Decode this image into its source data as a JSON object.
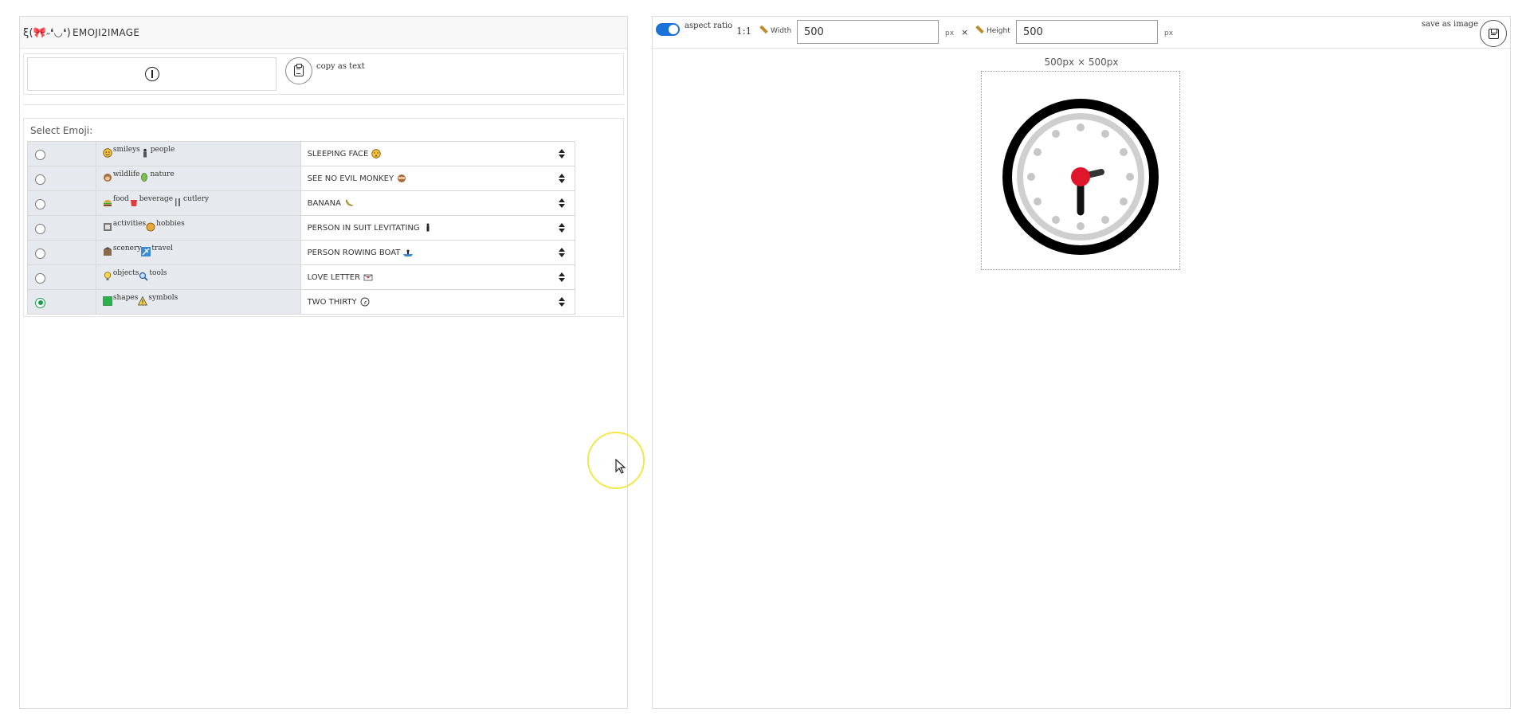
{
  "left": {
    "kaomoji": "ξ(🎀˶❛◡❛)",
    "title": "emoji2image",
    "copy_label": "copy as text",
    "select_title": "Select Emoji:",
    "rows": [
      {
        "cat1": "smileys",
        "cat2": "people",
        "selected": "SLEEPING FACE",
        "checked": false
      },
      {
        "cat1": "wildlife",
        "cat2": "nature",
        "selected": "SEE NO EVIL MONKEY",
        "checked": false
      },
      {
        "cat1": "food",
        "cat2": "beverage",
        "cat3": "cutlery",
        "selected": "BANANA",
        "checked": false
      },
      {
        "cat1": "activities",
        "cat2": "hobbies",
        "selected": "PERSON IN SUIT LEVITATING",
        "checked": false
      },
      {
        "cat1": "scenery",
        "cat2": "travel",
        "selected": "PERSON ROWING BOAT",
        "checked": false
      },
      {
        "cat1": "objects",
        "cat2": "tools",
        "selected": "LOVE LETTER",
        "checked": false
      },
      {
        "cat1": "shapes",
        "cat2": "symbols",
        "selected": "TWO THIRTY",
        "checked": true
      }
    ]
  },
  "right": {
    "aspect_label": "aspect ratio",
    "ratio": "1:1",
    "width_label": "Width",
    "width_value": "500",
    "px_unit": "px",
    "times": "×",
    "height_label": "Height",
    "height_value": "500",
    "save_label": "save as image",
    "size_caption": "500px × 500px"
  },
  "colors": {
    "accent": "#1a73d9",
    "radio_checked": "#1a9c4a",
    "clock_red": "#e0162b",
    "cursor_ring": "#f1e84a"
  }
}
